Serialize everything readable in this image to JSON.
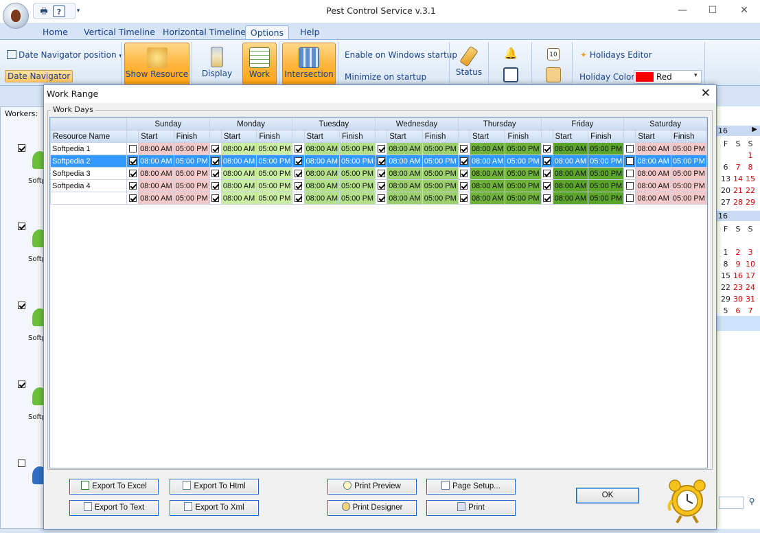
{
  "app": {
    "title": "Pest Control Service v.3.1",
    "window_buttons": {
      "minimize": "—",
      "maximize": "☐",
      "close": "✕"
    }
  },
  "tabs": [
    {
      "label": "Home"
    },
    {
      "label": "Vertical Timeline"
    },
    {
      "label": "Horizontal Timeline"
    },
    {
      "label": "Options",
      "active": true
    },
    {
      "label": "Help"
    }
  ],
  "ribbon": {
    "date_nav_position": "Date Navigator position",
    "date_navigator": "Date Navigator",
    "show_resource": "Show Resource",
    "display": "Display",
    "work": "Work",
    "intersection": "Intersection",
    "enable_startup": "Enable on Windows startup",
    "minimize_startup": "Minimize on startup",
    "status": "Status",
    "holidays_editor": "Holidays Editor",
    "holiday_color_label": "Holiday Color",
    "holiday_color_value": "Red",
    "holiday_color": "#ff0000"
  },
  "workers": {
    "label": "Workers:",
    "name_prefix": "Softp"
  },
  "calendar": {
    "year_top": "16",
    "year_bottom": "16",
    "headers": [
      "F",
      "S",
      "S"
    ],
    "rows_top": [
      [
        "",
        "",
        "1"
      ],
      [
        "6",
        "7",
        "8"
      ],
      [
        "13",
        "14",
        "15"
      ],
      [
        "20",
        "21",
        "22"
      ],
      [
        "27",
        "28",
        "29"
      ]
    ],
    "rows_bottom": [
      [
        "",
        "",
        ""
      ],
      [
        "1",
        "2",
        "3"
      ],
      [
        "8",
        "9",
        "10"
      ],
      [
        "15",
        "16",
        "17"
      ],
      [
        "22",
        "23",
        "24"
      ],
      [
        "29",
        "30",
        "31"
      ],
      [
        "5",
        "6",
        "7"
      ]
    ]
  },
  "dialog": {
    "title": "Work Range",
    "close": "✕",
    "group_label": "Work Days",
    "resource_header": "Resource Name",
    "start_label": "Start",
    "finish_label": "Finish",
    "days": [
      {
        "name": "Sunday",
        "color": "#f3c9c9"
      },
      {
        "name": "Monday",
        "color": "#c9eea4"
      },
      {
        "name": "Tuesday",
        "color": "#b3e18a"
      },
      {
        "name": "Wednesday",
        "color": "#9ccf6d"
      },
      {
        "name": "Thursday",
        "color": "#6fb33a"
      },
      {
        "name": "Friday",
        "color": "#5ba52b"
      },
      {
        "name": "Saturday",
        "color": "#f3c9c9"
      }
    ],
    "rows": [
      {
        "name": "Softpedia 1",
        "selected": false,
        "checks": [
          false,
          true,
          true,
          true,
          true,
          true,
          false
        ]
      },
      {
        "name": "Softpedia 2",
        "selected": true,
        "checks": [
          true,
          true,
          true,
          true,
          true,
          true,
          false
        ]
      },
      {
        "name": "Softpedia 3",
        "selected": false,
        "checks": [
          true,
          true,
          true,
          true,
          true,
          true,
          false
        ]
      },
      {
        "name": "Softpedia 4",
        "selected": false,
        "checks": [
          true,
          true,
          true,
          true,
          true,
          true,
          false
        ]
      },
      {
        "name": "",
        "selected": false,
        "checks": [
          true,
          true,
          true,
          true,
          true,
          true,
          false
        ]
      }
    ],
    "start_time": "08:00 AM",
    "finish_time": "05:00 PM",
    "buttons": {
      "export_excel": "Export To Excel",
      "export_html": "Export To Html",
      "export_text": "Export To Text",
      "export_xml": "Export To Xml",
      "print_preview": "Print Preview",
      "page_setup": "Page Setup...",
      "print_designer": "Print Designer",
      "print": "Print",
      "ok": "OK"
    }
  }
}
